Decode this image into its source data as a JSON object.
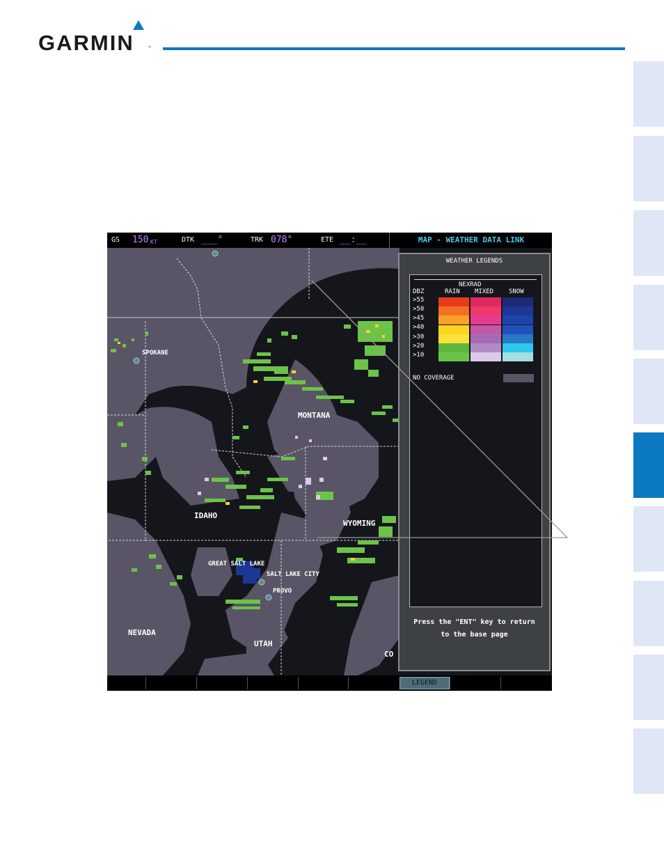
{
  "brand": {
    "name": "GARMIN",
    "tm": "™",
    "accent": "#0b79c1"
  },
  "side_tabs": {
    "count": 10,
    "active_index": 5
  },
  "topbar": {
    "gs_label": "GS",
    "gs_value": "150",
    "gs_unit": "KT",
    "dtk_label": "DTK",
    "dtk_value": "___°",
    "trk_label": "TRK",
    "trk_value": "078°",
    "ete_label": "ETE",
    "ete_value": "__:__",
    "page_name": "MAP - WEATHER DATA LINK"
  },
  "map_labels": {
    "spokane": "SPOKANE",
    "montana": "MONTANA",
    "idaho": "IDAHO",
    "wyoming": "WYOMING",
    "great_salt_lake": "GREAT SALT LAKE",
    "salt_lake_city": "SALT LAKE CITY",
    "provo": "PROVO",
    "nevada": "NEVADA",
    "utah": "UTAH",
    "colorado_partial": "CO"
  },
  "legend": {
    "title": "WEATHER LEGENDS",
    "section": "NEXRAD",
    "dbz_label": "DBZ",
    "columns": [
      "RAIN",
      "MIXED",
      "SNOW"
    ],
    "rows": [
      ">55",
      ">50",
      ">45",
      ">40",
      ">30",
      ">20",
      ">10"
    ],
    "rain_colors": [
      "#e83b1c",
      "#f46f22",
      "#f9a12a",
      "#fcd421",
      "#fbe13a",
      "#5db83f",
      "#6cc34a"
    ],
    "mixed_colors": [
      "#de2a60",
      "#ed3a6b",
      "#e43a8f",
      "#c458a8",
      "#a76bb6",
      "#b08bc4",
      "#dacbe6"
    ],
    "snow_colors": [
      "#1c2a78",
      "#1d3795",
      "#1c45a9",
      "#1f52bf",
      "#2b78c6",
      "#2ec6ea",
      "#a4dfe0"
    ],
    "no_coverage_label": "NO COVERAGE",
    "no_coverage_color": "#5a5566",
    "message_line1": "Press the \"ENT\" key to return",
    "message_line2": "to the base page"
  },
  "softkeys": {
    "legend_label": "LEGEND"
  }
}
